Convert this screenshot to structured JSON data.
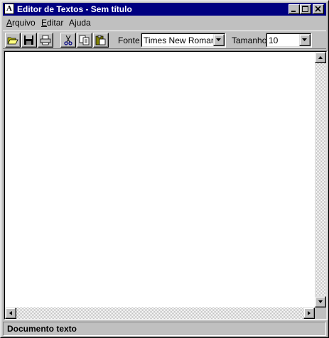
{
  "window": {
    "title": "Editor de Textos - Sem título",
    "icon_letter": "A"
  },
  "menu": {
    "items": [
      {
        "label_u": "A",
        "label_rest": "rquivo"
      },
      {
        "label_u": "E",
        "label_rest": "ditar"
      },
      {
        "label_pre": "A",
        "label_u": "j",
        "label_rest": "uda"
      }
    ]
  },
  "toolbar": {
    "font_label": "Fonte",
    "font_value": "Times New Roman",
    "size_label": "Tamanho",
    "size_value": "10"
  },
  "status": {
    "text": "Documento texto"
  },
  "colors": {
    "titlebar": "#000080",
    "face": "#c0c0c0",
    "editor_bg": "#ffffff"
  }
}
